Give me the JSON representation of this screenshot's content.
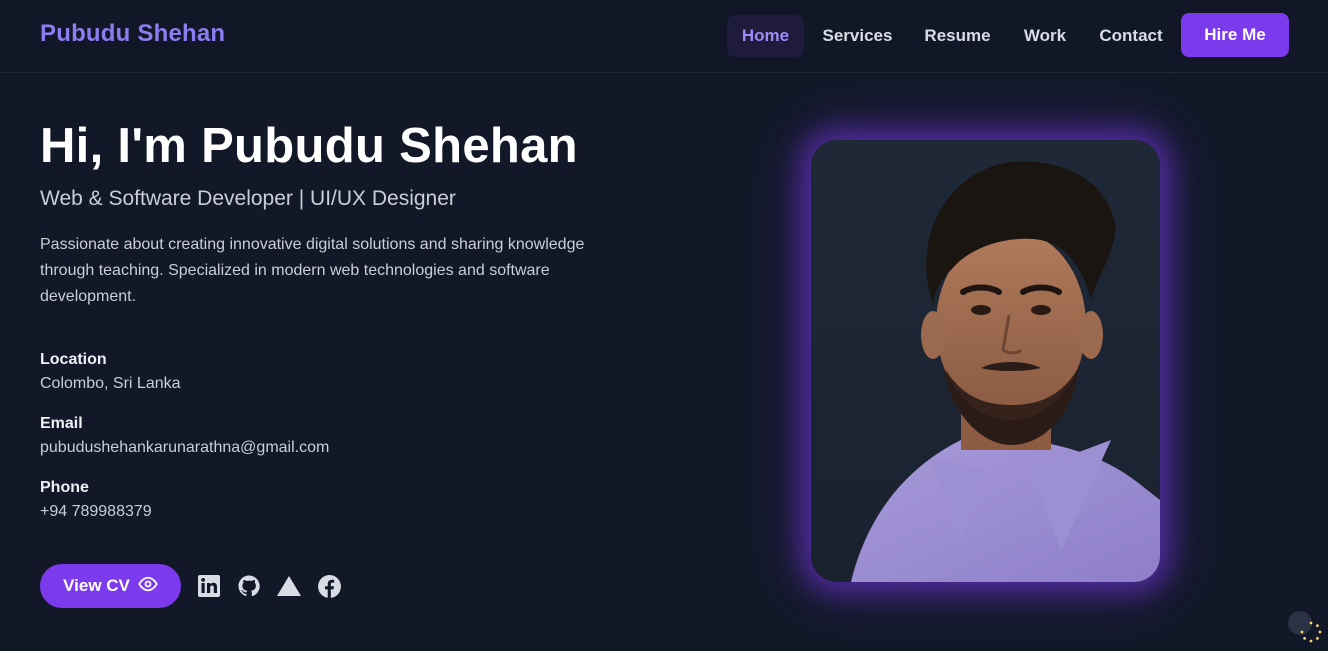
{
  "header": {
    "brand": "Pubudu Shehan",
    "nav": [
      {
        "label": "Home",
        "active": true
      },
      {
        "label": "Services",
        "active": false
      },
      {
        "label": "Resume",
        "active": false
      },
      {
        "label": "Work",
        "active": false
      },
      {
        "label": "Contact",
        "active": false
      }
    ],
    "hire_label": "Hire Me"
  },
  "hero": {
    "title": "Hi, I'm Pubudu Shehan",
    "subtitle": "Web & Software Developer | UI/UX Designer",
    "description": "Passionate about creating innovative digital solutions and sharing knowledge through teaching. Specialized in modern web technologies and software development.",
    "info": [
      {
        "label": "Location",
        "value": "Colombo, Sri Lanka"
      },
      {
        "label": "Email",
        "value": "pubudushehankarunarathna@gmail.com"
      },
      {
        "label": "Phone",
        "value": "+94 789988379"
      }
    ],
    "view_cv_label": "View CV",
    "socials": [
      "linkedin-icon",
      "github-icon",
      "triangle-icon",
      "facebook-icon"
    ]
  },
  "colors": {
    "accent": "#7c3aed",
    "brand": "#8b7cf0",
    "background": "#121827"
  }
}
